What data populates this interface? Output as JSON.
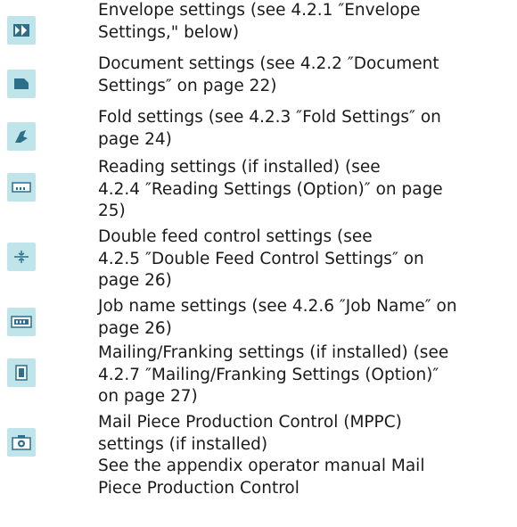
{
  "items": [
    {
      "icon": "envelope-settings-icon",
      "text": "Envelope settings (see 4.2.1 ″Envelope\nSettings,\" below)"
    },
    {
      "icon": "document-settings-icon",
      "text": "Document settings (see 4.2.2 ″Document\nSettings″ on page 22)"
    },
    {
      "icon": "fold-settings-icon",
      "text": "Fold settings (see 4.2.3 ″Fold Settings″ on\npage 24)"
    },
    {
      "icon": "reading-settings-icon",
      "text": "Reading settings (if installed) (see\n4.2.4 ″Reading Settings (Option)″ on page\n25)"
    },
    {
      "icon": "double-feed-control-icon",
      "text": "Double feed control settings (see\n4.2.5 ″Double Feed Control Settings″ on\npage 26)"
    },
    {
      "icon": "job-name-icon",
      "text": "Job name settings (see 4.2.6 ″Job Name″ on\npage 26)"
    },
    {
      "icon": "mailing-franking-icon",
      "text": "Mailing/Franking settings (if installed) (see\n4.2.7 ″Mailing/Franking Settings (Option)″\non page 27)"
    },
    {
      "icon": "mppc-camera-icon",
      "text": "Mail Piece Production Control (MPPC)\nsettings (if installed)\nSee the appendix operator manual Mail\nPiece Production Control"
    }
  ],
  "colors": {
    "icon_bg": "#bfe4ea",
    "icon_fg": "#2d6e88",
    "text": "#1a1a1a"
  }
}
